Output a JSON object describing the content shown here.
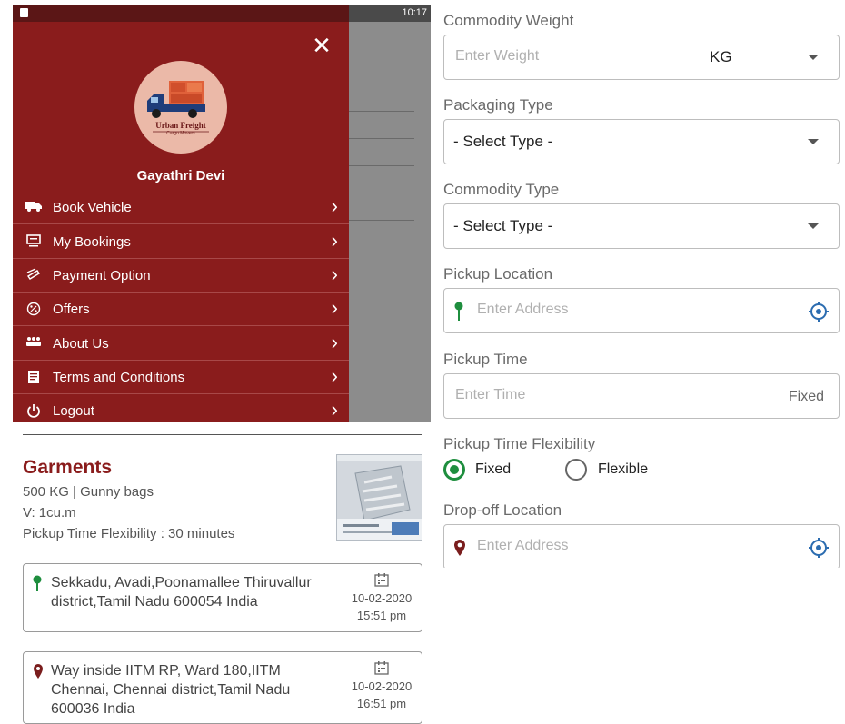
{
  "status_bar": {
    "time": "10:17"
  },
  "drawer": {
    "brand": "Urban Freight",
    "brand_sub": "Cargo Movers",
    "user_name": "Gayathri Devi",
    "menu": [
      {
        "label": "Book Vehicle",
        "icon": "truck-icon"
      },
      {
        "label": "My Bookings",
        "icon": "monitor-icon"
      },
      {
        "label": "Payment Option",
        "icon": "money-icon"
      },
      {
        "label": "Offers",
        "icon": "discount-icon"
      },
      {
        "label": "About Us",
        "icon": "people-icon"
      },
      {
        "label": "Terms and Conditions",
        "icon": "document-icon"
      },
      {
        "label": "Logout",
        "icon": "power-icon"
      }
    ]
  },
  "booking": {
    "title": "Garments",
    "weight_packaging": "500 KG | Gunny bags",
    "volume": "V: 1cu.m",
    "flexibility": "Pickup Time Flexibility : 30 minutes",
    "pickup": {
      "address": "Sekkadu, Avadi,Poonamallee Thiruvallur district,Tamil Nadu 600054 India",
      "date": "10-02-2020",
      "time": "15:51 pm"
    },
    "drop": {
      "address": "Way inside IITM RP, Ward 180,IITM Chennai, Chennai district,Tamil Nadu 600036 India",
      "date": "10-02-2020",
      "time": "16:51 pm"
    }
  },
  "form": {
    "weight": {
      "label": "Commodity Weight",
      "placeholder": "Enter Weight",
      "unit": "KG"
    },
    "packaging": {
      "label": "Packaging Type",
      "value": "- Select Type -"
    },
    "commodity": {
      "label": "Commodity Type",
      "value": "- Select Type -"
    },
    "pickup_location": {
      "label": "Pickup Location",
      "placeholder": "Enter Address"
    },
    "pickup_time": {
      "label": "Pickup Time",
      "placeholder": "Enter Time",
      "tag": "Fixed"
    },
    "flexibility": {
      "label": "Pickup Time Flexibility",
      "options": [
        "Fixed",
        "Flexible"
      ],
      "selected": "Fixed"
    },
    "dropoff_location": {
      "label": "Drop-off Location",
      "placeholder": "Enter Address"
    }
  },
  "colors": {
    "brand_maroon": "#8a1c1c",
    "pickup_pin": "#1e8e3e",
    "drop_pin": "#7a1d1d",
    "accent_blue": "#2b6cb0"
  }
}
